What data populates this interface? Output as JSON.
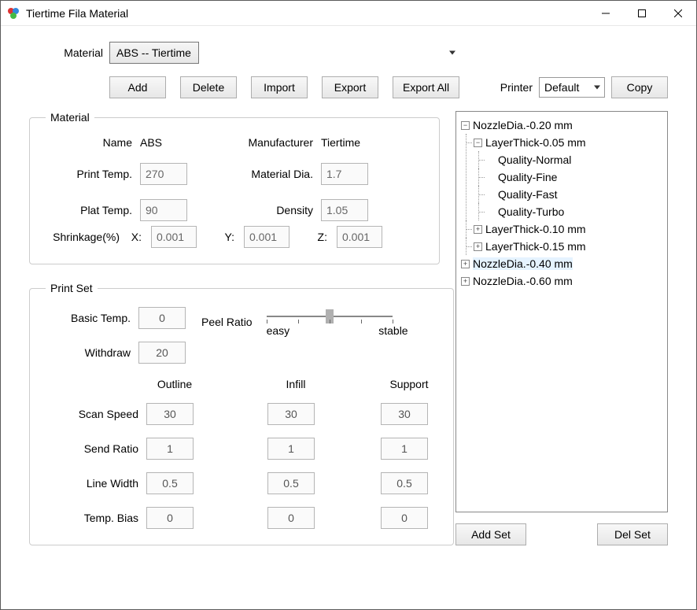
{
  "window": {
    "title": "Tiertime Fila Material"
  },
  "material_dropdown": {
    "label": "Material",
    "selected": "ABS -- Tiertime"
  },
  "toolbar": {
    "add": "Add",
    "delete": "Delete",
    "import": "Import",
    "export": "Export",
    "export_all": "Export All"
  },
  "printer": {
    "label": "Printer",
    "selected": "Default",
    "copy": "Copy"
  },
  "material_group": {
    "legend": "Material",
    "name_label": "Name",
    "name_value": "ABS",
    "manufacturer_label": "Manufacturer",
    "manufacturer_value": "Tiertime",
    "print_temp_label": "Print Temp.",
    "print_temp_value": "270",
    "material_dia_label": "Material Dia.",
    "material_dia_value": "1.7",
    "plat_temp_label": "Plat Temp.",
    "plat_temp_value": "90",
    "density_label": "Density",
    "density_value": "1.05",
    "shrinkage_label": "Shrinkage(%)",
    "x_label": "X:",
    "x_value": "0.001",
    "y_label": "Y:",
    "y_value": "0.001",
    "z_label": "Z:",
    "z_value": "0.001"
  },
  "print_set": {
    "legend": "Print Set",
    "basic_temp_label": "Basic Temp.",
    "basic_temp_value": "0",
    "withdraw_label": "Withdraw",
    "withdraw_value": "20",
    "peel_ratio_label": "Peel Ratio",
    "peel_easy": "easy",
    "peel_stable": "stable",
    "col_outline": "Outline",
    "col_infill": "Infill",
    "col_support": "Support",
    "scan_speed_label": "Scan Speed",
    "scan_speed": {
      "outline": "30",
      "infill": "30",
      "support": "30"
    },
    "send_ratio_label": "Send Ratio",
    "send_ratio": {
      "outline": "1",
      "infill": "1",
      "support": "1"
    },
    "line_width_label": "Line Width",
    "line_width": {
      "outline": "0.5",
      "infill": "0.5",
      "support": "0.5"
    },
    "temp_bias_label": "Temp. Bias",
    "temp_bias": {
      "outline": "0",
      "infill": "0",
      "support": "0"
    }
  },
  "tree": {
    "n0": "NozzleDia.-0.20 mm",
    "n0_l0": "LayerThick-0.05 mm",
    "n0_l0_q0": "Quality-Normal",
    "n0_l0_q1": "Quality-Fine",
    "n0_l0_q2": "Quality-Fast",
    "n0_l0_q3": "Quality-Turbo",
    "n0_l1": "LayerThick-0.10 mm",
    "n0_l2": "LayerThick-0.15 mm",
    "n1": "NozzleDia.-0.40 mm",
    "n2": "NozzleDia.-0.60 mm"
  },
  "right_buttons": {
    "add_set": "Add Set",
    "del_set": "Del Set"
  }
}
